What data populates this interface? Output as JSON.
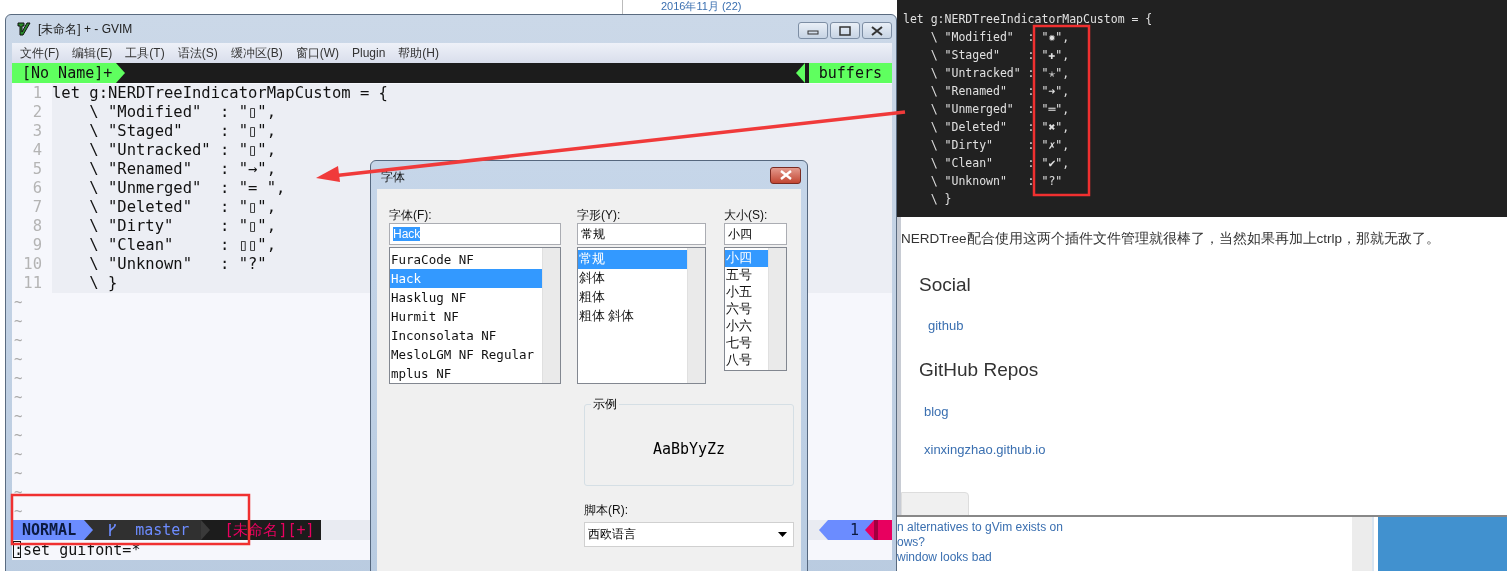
{
  "archive_link": "2016年11月 (22)",
  "code_snippet": {
    "lines": [
      "let g:NERDTreeIndicatorMapCustom = {",
      "    \\ \"Modified\"  : \"✹\",",
      "    \\ \"Staged\"    : \"✚\",",
      "    \\ \"Untracked\" : \"✭\",",
      "    \\ \"Renamed\"   : \"➜\",",
      "    \\ \"Unmerged\"  : \"═\",",
      "    \\ \"Deleted\"   : \"✖\",",
      "    \\ \"Dirty\"     : \"✗\",",
      "    \\ \"Clean\"     : \"✔\",",
      "    \\ \"Unknown\"   : \"?\"",
      "    \\ }"
    ]
  },
  "blog": {
    "sentence": "NERDTree配合使用这两个插件文件管理就很棒了，当然如果再加上ctrlp，那就无敌了。",
    "social_heading": "Social",
    "social_links": [
      "github"
    ],
    "repos_heading": "GitHub Repos",
    "repo_links": [
      "blog",
      "xinxingzhao.github.io"
    ]
  },
  "related_questions": [
    "n alternatives to gVim exists on",
    "ows?",
    "window looks bad"
  ],
  "gvim": {
    "title": "[未命名] + - GVIM",
    "menu": [
      "文件(F)",
      "编辑(E)",
      "工具(T)",
      "语法(S)",
      "缓冲区(B)",
      "窗口(W)",
      "Plugin",
      "帮助(H)"
    ],
    "tab": "[No Name]+",
    "buffers_label": "buffers",
    "lines": [
      {
        "number": "1",
        "text": "let g:NERDTreeIndicatorMapCustom = {"
      },
      {
        "number": "2",
        "text": "    \\ \"Modified\"  : \"▯\","
      },
      {
        "number": "3",
        "text": "    \\ \"Staged\"    : \"▯\","
      },
      {
        "number": "4",
        "text": "    \\ \"Untracked\" : \"▯\","
      },
      {
        "number": "5",
        "text": "    \\ \"Renamed\"   : \"→\","
      },
      {
        "number": "6",
        "text": "    \\ \"Unmerged\"  : \"= \","
      },
      {
        "number": "7",
        "text": "    \\ \"Deleted\"   : \"▯\","
      },
      {
        "number": "8",
        "text": "    \\ \"Dirty\"     : \"▯\","
      },
      {
        "number": "9",
        "text": "    \\ \"Clean\"     : ▯▯\","
      },
      {
        "number": "10",
        "text": "    \\ \"Unknown\"   : \"?\""
      },
      {
        "number": "11",
        "text": "    \\ }"
      }
    ],
    "tildes": [
      "~",
      "~",
      "~",
      "~",
      "~",
      "~",
      "~",
      "~",
      "~",
      "~",
      "~",
      "~"
    ],
    "statusline": {
      "mode": "NORMAL",
      "branch": "master",
      "file": "[未命名][+]",
      "line": "1"
    },
    "cmdline": ":set guifont=*"
  },
  "font_dialog": {
    "title": "字体",
    "font": {
      "label": "字体(F):",
      "value": "Hack",
      "items": [
        {
          "label": "FuraCode NF",
          "selected": false
        },
        {
          "label": "Hack",
          "selected": true
        },
        {
          "label": "Hasklug NF",
          "selected": false
        },
        {
          "label": "Hurmit NF",
          "selected": false
        },
        {
          "label": "Inconsolata NF",
          "selected": false
        },
        {
          "label": "MesloLGM NF Regular",
          "selected": false
        },
        {
          "label": "mplus NF",
          "selected": false
        }
      ]
    },
    "style": {
      "label": "字形(Y):",
      "value": "常规",
      "items": [
        {
          "label": "常规",
          "selected": true
        },
        {
          "label": "斜体",
          "selected": false
        },
        {
          "label": "粗体",
          "selected": false
        },
        {
          "label": "粗体 斜体",
          "selected": false
        }
      ]
    },
    "size": {
      "label": "大小(S):",
      "value": "小四",
      "items": [
        {
          "label": "小四",
          "selected": true
        },
        {
          "label": "五号",
          "selected": false
        },
        {
          "label": "小五",
          "selected": false
        },
        {
          "label": "六号",
          "selected": false
        },
        {
          "label": "小六",
          "selected": false
        },
        {
          "label": "七号",
          "selected": false
        },
        {
          "label": "八号",
          "selected": false
        }
      ]
    },
    "sample": {
      "label": "示例",
      "text": "AaBbYyZz"
    },
    "script": {
      "label": "脚本(R):",
      "value": "西欧语言"
    }
  }
}
